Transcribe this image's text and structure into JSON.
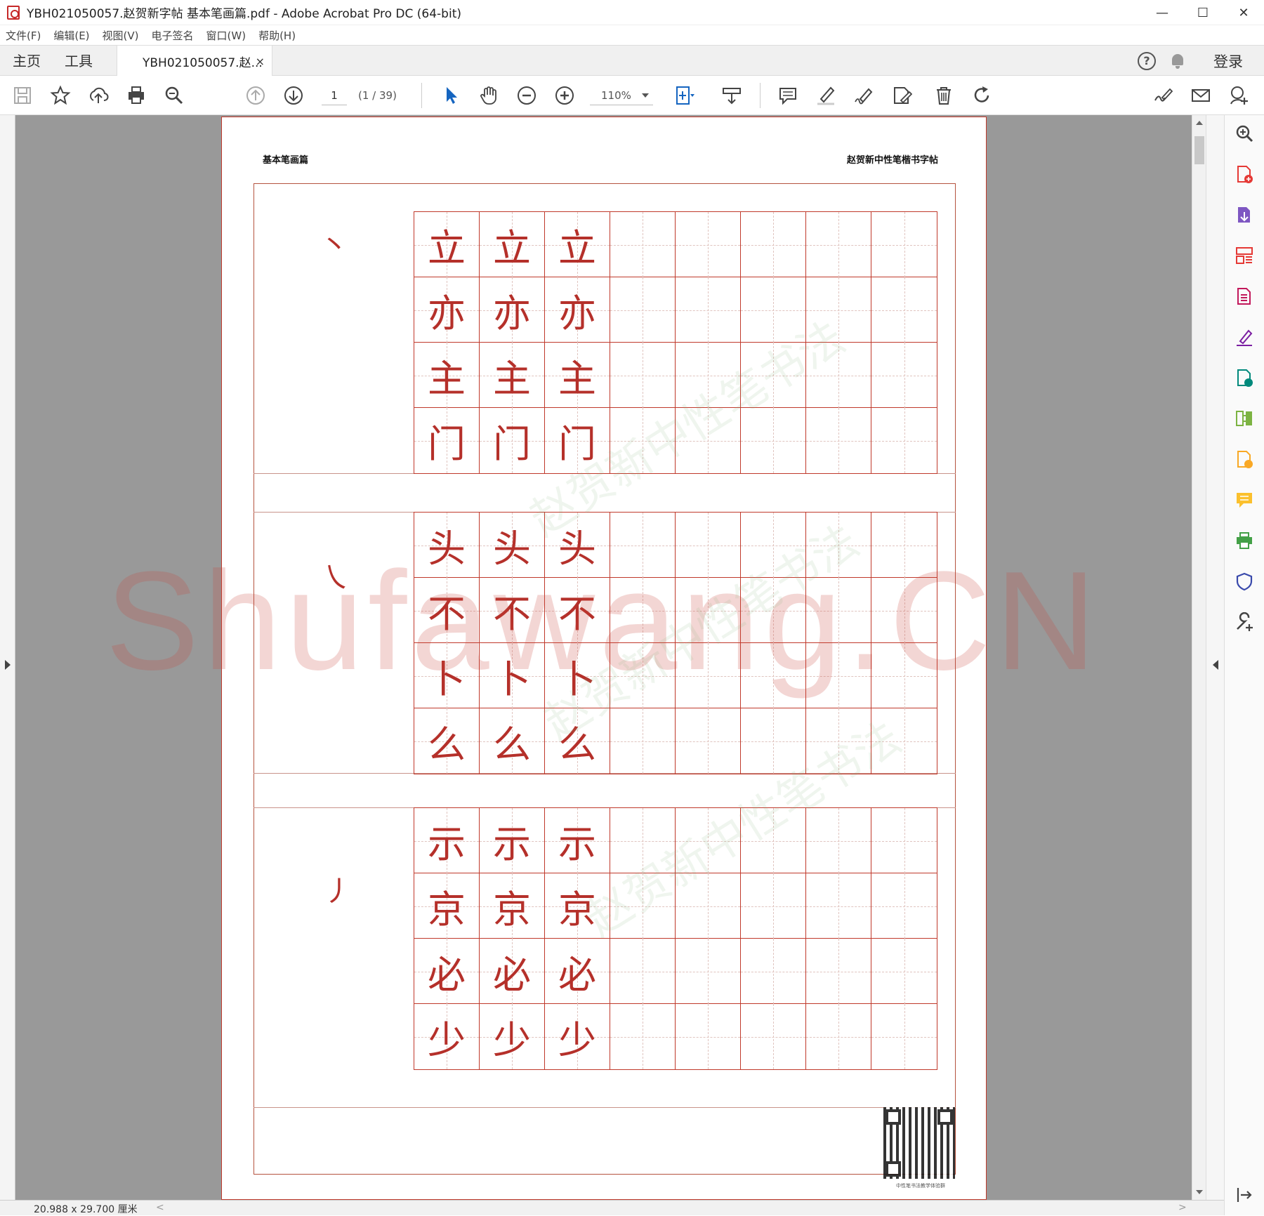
{
  "window": {
    "title": "YBH021050057.赵贺新字帖 基本笔画篇.pdf - Adobe Acrobat Pro DC (64-bit)",
    "minimize": "—",
    "maximize": "☐",
    "close": "✕"
  },
  "menu": [
    "文件(F)",
    "编辑(E)",
    "视图(V)",
    "电子签名",
    "窗口(W)",
    "帮助(H)"
  ],
  "tabs": {
    "home": "主页",
    "tools": "工具",
    "document": "YBH021050057.赵...",
    "close": "×",
    "login": "登录",
    "help": "?"
  },
  "toolbar": {
    "page_current": "1",
    "page_count": "(1 / 39)",
    "zoom": "110%"
  },
  "document": {
    "header_left": "基本笔画篇",
    "header_right": "赵贺新中性笔楷书字帖",
    "sections": [
      {
        "stroke": "丶",
        "rows": [
          "立",
          "亦",
          "主",
          "门"
        ]
      },
      {
        "stroke": "㇏",
        "rows": [
          "头",
          "不",
          "卜",
          "么"
        ]
      },
      {
        "stroke": "丿",
        "rows": [
          "示",
          "京",
          "必",
          "少"
        ]
      }
    ],
    "watermark": "Shufawang.CN",
    "watermark2": "赵贺新中性笔书法",
    "qr_caption": "中性笔书法教学体验群"
  },
  "status": {
    "dimensions": "20.988 x 29.700 厘米"
  },
  "colors": {
    "accent": "#c0392b",
    "doc_bg": "#999999",
    "ink": "#b5302a"
  }
}
